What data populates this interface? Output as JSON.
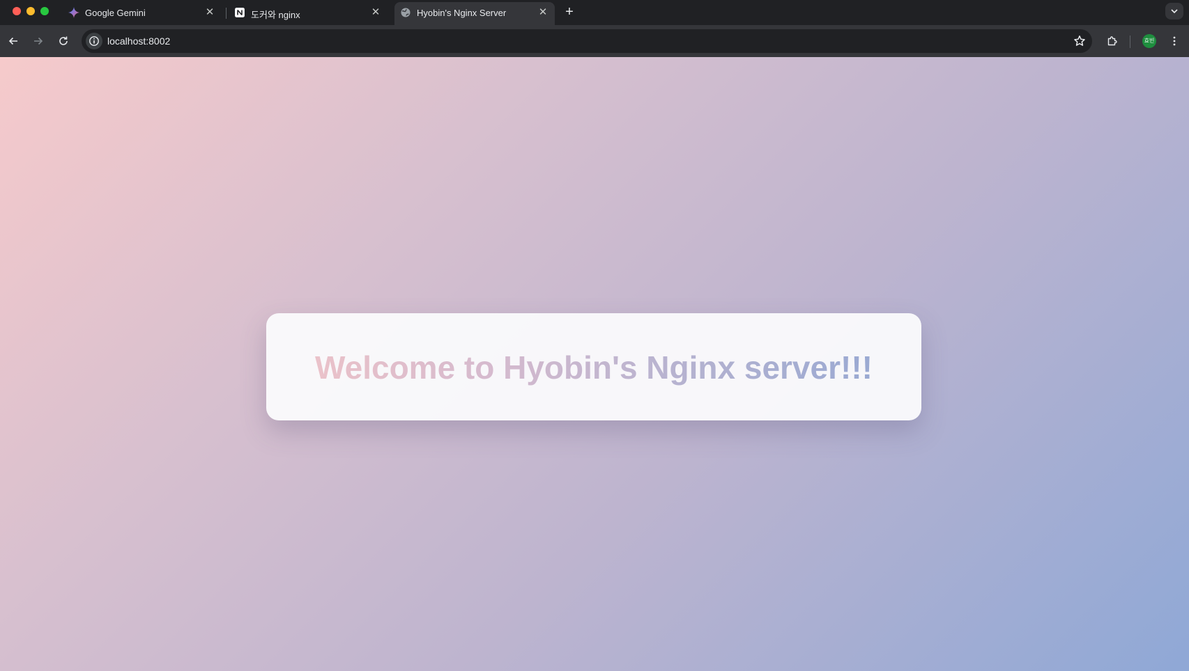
{
  "window_controls": {
    "close_color": "#ff5f57",
    "minimize_color": "#febc2e",
    "maximize_color": "#28c840"
  },
  "tabs": [
    {
      "title": "Google Gemini",
      "icon": "gemini-sparkle-icon",
      "active": false
    },
    {
      "title": "도커와 nginx",
      "icon": "notion-icon",
      "active": false
    },
    {
      "title": "Hyobin's Nginx Server",
      "icon": "globe-icon",
      "active": true
    }
  ],
  "toolbar": {
    "url": "localhost:8002",
    "profile_initials": "효빈",
    "profile_color": "#1e8e3e"
  },
  "page": {
    "heading": "Welcome to Hyobin's Nginx server!!!",
    "gradient_colors": [
      "#f6cacb",
      "#d8c0cf",
      "#bdb4cf",
      "#8fa8d6"
    ]
  }
}
